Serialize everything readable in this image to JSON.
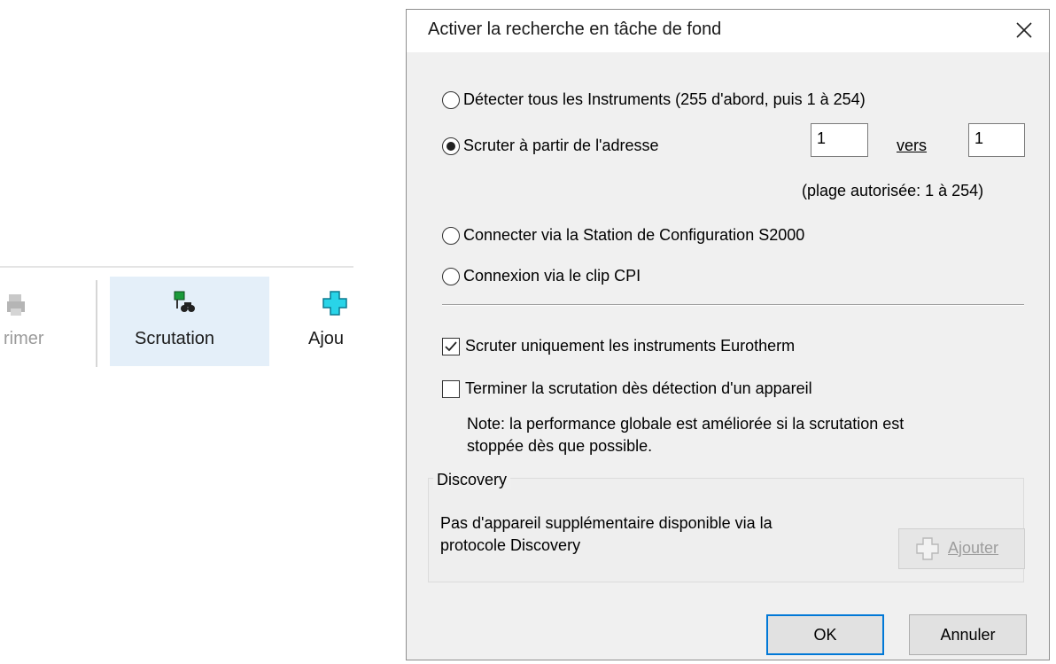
{
  "toolbar": {
    "print_label": "rimer",
    "scan_label": "Scrutation",
    "add_label": "Ajou"
  },
  "dialog": {
    "title": "Activer la recherche en tâche de fond",
    "options": {
      "detect_all": "Détecter tous les Instruments (255 d'abord, puis 1 à 254)",
      "scan_from": "Scruter à partir de l'adresse",
      "connect_station": "Connecter via la Station de Configuration S2000",
      "connect_cpi": "Connexion via le clip CPI"
    },
    "selected_option": "scan_from",
    "address_from": "1",
    "vers_label": "vers",
    "address_to": "1",
    "range_hint": "(plage autorisée: 1 à 254)",
    "check_eurotherm": "Scruter uniquement les instruments Eurotherm",
    "check_eurotherm_checked": true,
    "check_stop": "Terminer la scrutation dès détection d'un appareil",
    "check_stop_checked": false,
    "note_line1": "Note: la performance globale est améliorée si la scrutation est",
    "note_line2": "stoppée dès que possible.",
    "discovery": {
      "legend": "Discovery",
      "message_line1": "Pas d'appareil supplémentaire disponible via la",
      "message_line2": "protocole Discovery",
      "add_button": "Ajouter"
    },
    "ok_button": "OK",
    "cancel_button": "Annuler"
  },
  "colors": {
    "accent": "#0078d7",
    "selected_toolbar_bg": "#e4eff9",
    "dialog_bg": "#f0f0f0"
  },
  "icons": [
    "printer-icon",
    "scan-binoculars-icon",
    "add-plus-icon",
    "close-icon",
    "checkmark-icon"
  ]
}
